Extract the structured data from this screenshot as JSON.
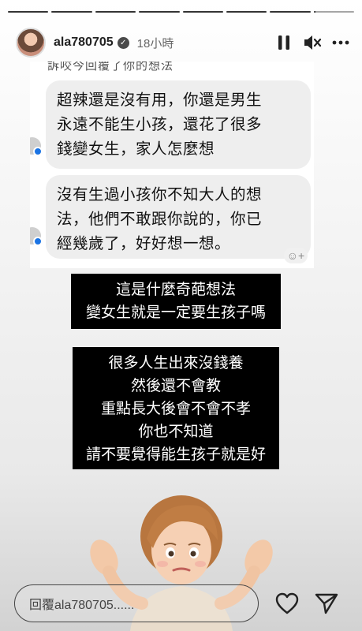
{
  "story": {
    "segments_total": 8,
    "segments_done": 7,
    "current_progress": 0.05
  },
  "header": {
    "username": "ala780705",
    "time": "18小時",
    "verified_icon": "verified-badge-icon",
    "pause_icon": "pause-icon",
    "mute_icon": "muted-speaker-icon",
    "more_icon": "more-dots-icon"
  },
  "screenshot": {
    "cut_off_text": "訴咬今回覆了你的想法",
    "messages": [
      {
        "lines": [
          "超辣還是沒有用，你還是男生",
          "永遠不能生小孩，還花了很多",
          "錢變女生，家人怎麼想"
        ]
      },
      {
        "lines": [
          "沒有生過小孩你不知大人的想",
          "法，他們不敢跟你說的，你已",
          "經幾歲了，好好想一想。"
        ]
      }
    ],
    "messenger_icon": "messenger-icon",
    "reaction_icon": "add-reaction-icon"
  },
  "captions": [
    {
      "lines": [
        "這是什麼奇葩想法",
        "變女生就是一定要生孩子嗎"
      ]
    },
    {
      "lines": [
        "很多人生出來沒錢養",
        "然後還不會教",
        "重點長大後會不會不孝",
        "你也不知道",
        "請不要覺得能生孩子就是好"
      ]
    }
  ],
  "sticker": {
    "name": "memoji-shrug-sticker"
  },
  "footer": {
    "reply_placeholder": "回覆ala780705......",
    "like_icon": "heart-icon",
    "share_icon": "send-icon"
  }
}
